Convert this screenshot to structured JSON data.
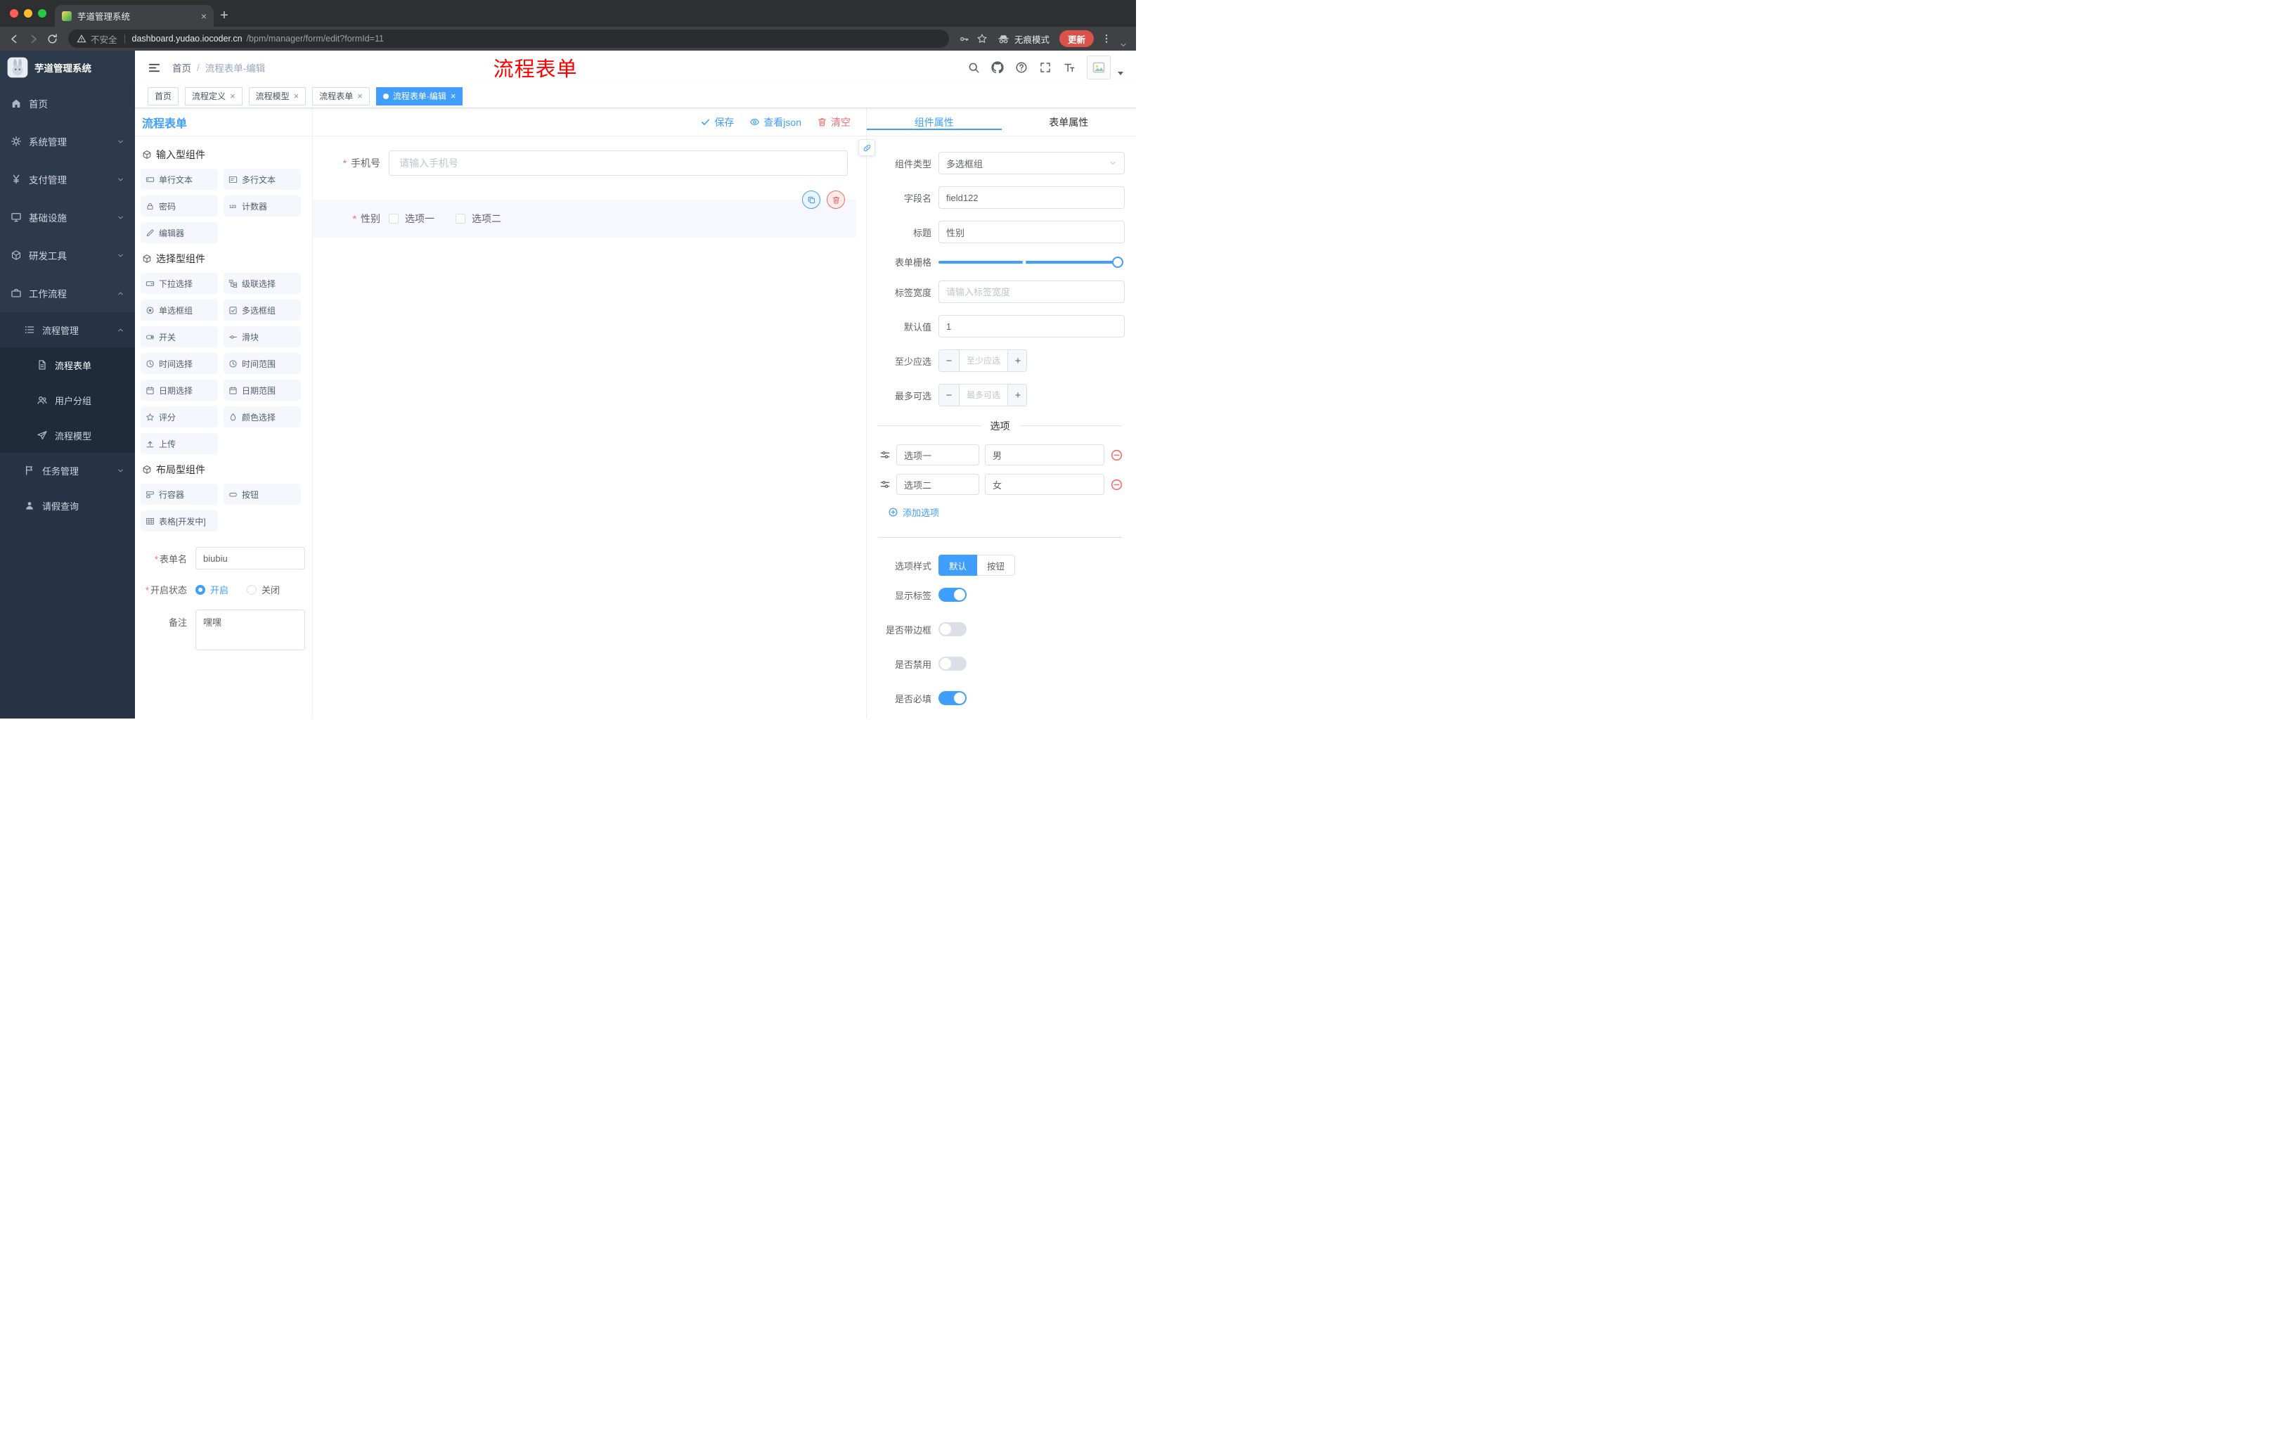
{
  "theme": {
    "accent": "#409eff",
    "danger": "#f56c6c",
    "sidebar_bg": "#2d3a4b",
    "overlay_red": "#ff0000"
  },
  "browser": {
    "tab": {
      "title": "芋道管理系统"
    },
    "url": {
      "security": "不安全",
      "domain": "dashboard.yudao.iocoder.cn",
      "path": "/bpm/manager/form/edit?formId=11"
    },
    "incognito": "无痕模式",
    "update": "更新"
  },
  "sidebar": {
    "logo": "芋道管理系统",
    "items": [
      {
        "label": "首页"
      },
      {
        "label": "系统管理"
      },
      {
        "label": "支付管理"
      },
      {
        "label": "基础设施"
      },
      {
        "label": "研发工具"
      },
      {
        "label": "工作流程"
      },
      {
        "label": "流程管理"
      },
      {
        "label": "流程表单"
      },
      {
        "label": "用户分组"
      },
      {
        "label": "流程模型"
      },
      {
        "label": "任务管理"
      },
      {
        "label": "请假查询"
      }
    ]
  },
  "header": {
    "breadcrumb": {
      "home": "首页",
      "current": "流程表单-编辑"
    },
    "overlay_title": "流程表单"
  },
  "tags": [
    {
      "label": "首页"
    },
    {
      "label": "流程定义"
    },
    {
      "label": "流程模型"
    },
    {
      "label": "流程表单"
    },
    {
      "label": "流程表单-编辑"
    }
  ],
  "designer": {
    "title": "流程表单",
    "actions": {
      "save": "保存",
      "view_json": "查看json",
      "clear": "清空"
    },
    "groups": [
      {
        "title": "输入型组件",
        "items": [
          "单行文本",
          "多行文本",
          "密码",
          "计数器",
          "编辑器"
        ]
      },
      {
        "title": "选择型组件",
        "items": [
          "下拉选择",
          "级联选择",
          "单选框组",
          "多选框组",
          "开关",
          "滑块",
          "时间选择",
          "时间范围",
          "日期选择",
          "日期范围",
          "评分",
          "颜色选择",
          "上传"
        ]
      },
      {
        "title": "布局型组件",
        "items": [
          "行容器",
          "按钮",
          "表格[开发中]"
        ]
      }
    ],
    "meta": {
      "form_name_label": "表单名",
      "form_name_value": "biubiu",
      "status_label": "开启状态",
      "status_on": "开启",
      "status_off": "关闭",
      "remark_label": "备注",
      "remark_value": "嘿嘿"
    },
    "canvas": {
      "phone": {
        "label": "手机号",
        "placeholder": "请输入手机号"
      },
      "gender": {
        "label": "性别",
        "options": [
          "选项一",
          "选项二"
        ]
      }
    }
  },
  "props": {
    "tab_component": "组件属性",
    "tab_form": "表单属性",
    "component_type": {
      "label": "组件类型",
      "value": "多选框组"
    },
    "field_name": {
      "label": "字段名",
      "value": "field122"
    },
    "title": {
      "label": "标题",
      "value": "性别"
    },
    "grid": {
      "label": "表单栅格"
    },
    "label_width": {
      "label": "标签宽度",
      "placeholder": "请输入标签宽度"
    },
    "default_value": {
      "label": "默认值",
      "value": "1"
    },
    "min_select": {
      "label": "至少应选",
      "placeholder": "至少应选"
    },
    "max_select": {
      "label": "最多可选",
      "placeholder": "最多可选"
    },
    "options": {
      "divider": "选项",
      "rows": [
        {
          "label": "选项一",
          "value": "男"
        },
        {
          "label": "选项二",
          "value": "女"
        }
      ],
      "add": "添加选项"
    },
    "option_style": {
      "label": "选项样式",
      "default": "默认",
      "button": "按钮"
    },
    "toggles": [
      {
        "label": "显示标签",
        "on": true
      },
      {
        "label": "是否带边框",
        "on": false
      },
      {
        "label": "是否禁用",
        "on": false
      },
      {
        "label": "是否必填",
        "on": true
      }
    ]
  }
}
